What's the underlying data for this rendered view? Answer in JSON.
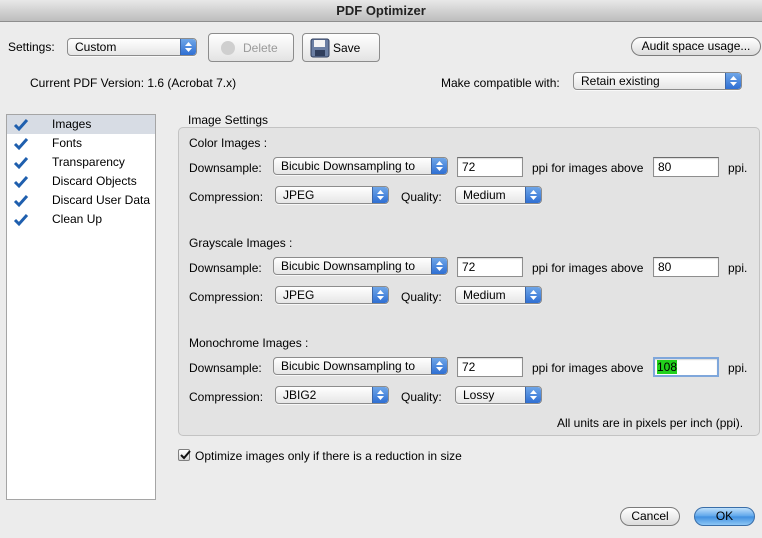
{
  "window": {
    "title": "PDF Optimizer"
  },
  "toolbar": {
    "settings_label": "Settings:",
    "settings_value": "Custom",
    "delete_label": "Delete",
    "save_label": "Save",
    "audit_label": "Audit space usage..."
  },
  "version": {
    "current_text": "Current PDF Version: 1.6 (Acrobat 7.x)",
    "compatible_label": "Make compatible with:",
    "compatible_value": "Retain existing"
  },
  "sidebar": {
    "items": [
      {
        "label": "Images",
        "checked": true,
        "selected": true
      },
      {
        "label": "Fonts",
        "checked": true
      },
      {
        "label": "Transparency",
        "checked": true
      },
      {
        "label": "Discard Objects",
        "checked": true
      },
      {
        "label": "Discard User Data",
        "checked": true
      },
      {
        "label": "Clean Up",
        "checked": true
      }
    ]
  },
  "image_settings": {
    "title": "Image Settings",
    "downsample_label": "Downsample:",
    "compression_label": "Compression:",
    "quality_label": "Quality:",
    "ppi_above_label": "ppi for images above",
    "ppi_label": "ppi.",
    "color": {
      "title": "Color Images :",
      "downsample": "Bicubic Downsampling to",
      "ppi": "72",
      "above": "80",
      "compression": "JPEG",
      "quality": "Medium"
    },
    "grayscale": {
      "title": "Grayscale Images :",
      "downsample": "Bicubic Downsampling to",
      "ppi": "72",
      "above": "80",
      "compression": "JPEG",
      "quality": "Medium"
    },
    "mono": {
      "title": "Monochrome Images :",
      "downsample": "Bicubic Downsampling to",
      "ppi": "72",
      "above": "108",
      "compression": "JBIG2",
      "quality": "Lossy"
    },
    "units_note": "All units are in pixels per inch (ppi)."
  },
  "optimize_option": {
    "label": "Optimize images only if there is a reduction in size",
    "checked": true
  },
  "footer": {
    "cancel_label": "Cancel",
    "ok_label": "OK"
  },
  "colors": {
    "accent": "#3f8fe0",
    "highlight": "#22d11c",
    "selection": "#d7dce4"
  }
}
